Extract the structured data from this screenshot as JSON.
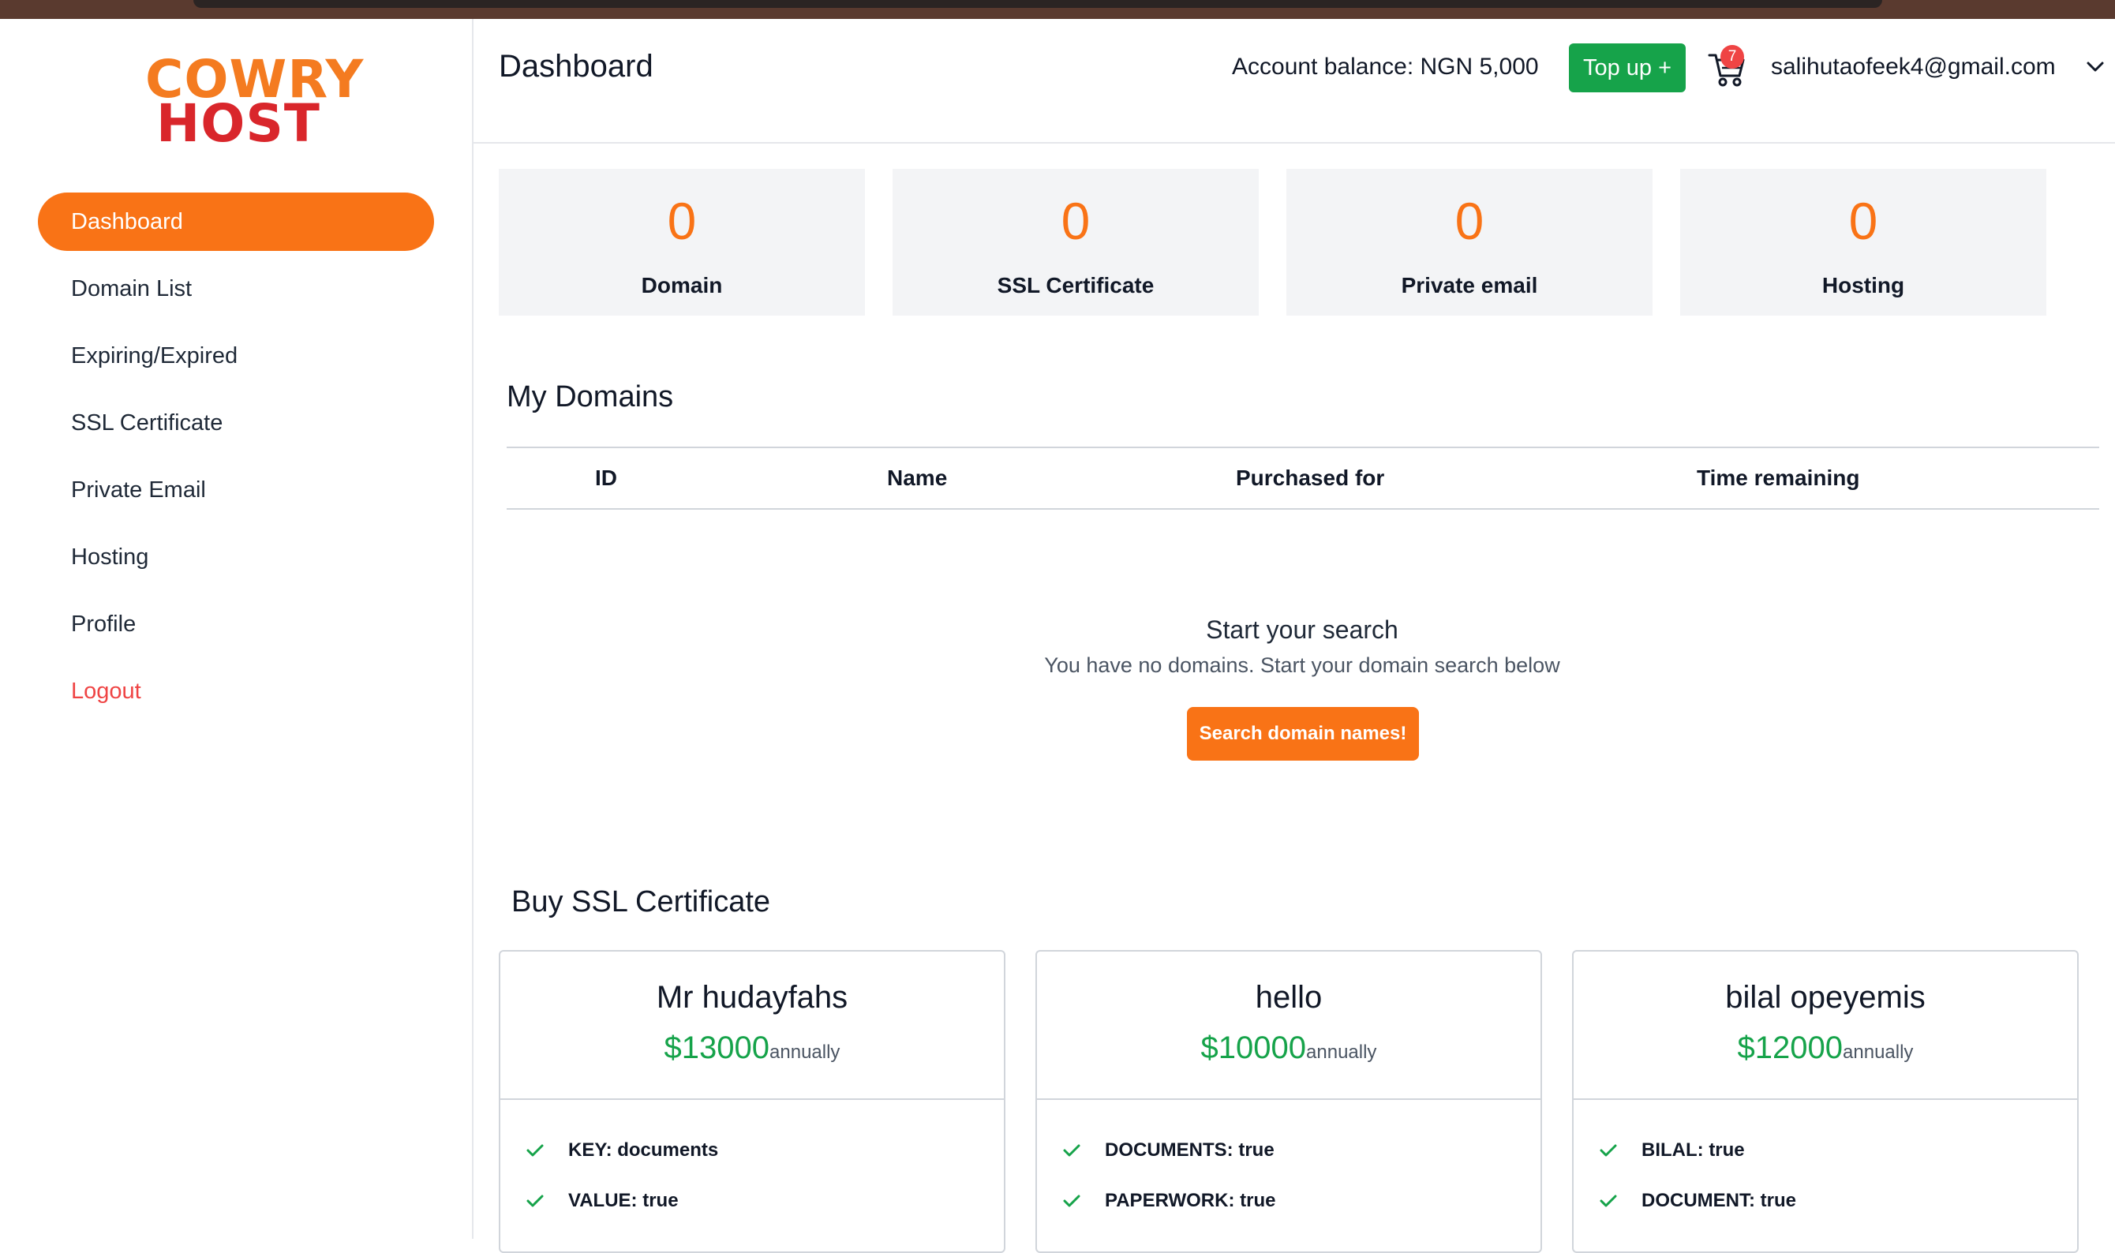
{
  "brand": {
    "line1": "COWRY",
    "line2": "HOST"
  },
  "sidebar": {
    "items": [
      {
        "label": "Dashboard"
      },
      {
        "label": "Domain List"
      },
      {
        "label": "Expiring/Expired"
      },
      {
        "label": "SSL Certificate"
      },
      {
        "label": "Private Email"
      },
      {
        "label": "Hosting"
      },
      {
        "label": "Profile"
      },
      {
        "label": "Logout"
      }
    ]
  },
  "header": {
    "title": "Dashboard",
    "balance": "Account balance: NGN 5,000",
    "topup_label": "Top up +",
    "cart_count": "7",
    "user_email": "salihutaofeek4@gmail.com"
  },
  "stats": [
    {
      "value": "0",
      "label": "Domain"
    },
    {
      "value": "0",
      "label": "SSL Certificate"
    },
    {
      "value": "0",
      "label": "Private email"
    },
    {
      "value": "0",
      "label": "Hosting"
    }
  ],
  "domains": {
    "title": "My Domains",
    "columns": [
      "ID",
      "Name",
      "Purchased for",
      "Time remaining"
    ],
    "empty_title": "Start your search",
    "empty_sub": "You have no domains. Start your domain search below",
    "search_button": "Search domain names!"
  },
  "ssl": {
    "title": "Buy SSL Certificate",
    "cards": [
      {
        "name": "Mr hudayfahs",
        "price": "$13000",
        "period": "annually",
        "features": [
          "KEY: documents",
          "VALUE: true"
        ]
      },
      {
        "name": "hello",
        "price": "$10000",
        "period": "annually",
        "features": [
          "DOCUMENTS: true",
          "PAPERWORK: true"
        ]
      },
      {
        "name": "bilal opeyemis",
        "price": "$12000",
        "period": "annually",
        "features": [
          "BILAL: true",
          "DOCUMENT: true"
        ]
      }
    ]
  },
  "colors": {
    "accent": "#f97316",
    "success": "#16a34a",
    "danger": "#ef4444"
  }
}
